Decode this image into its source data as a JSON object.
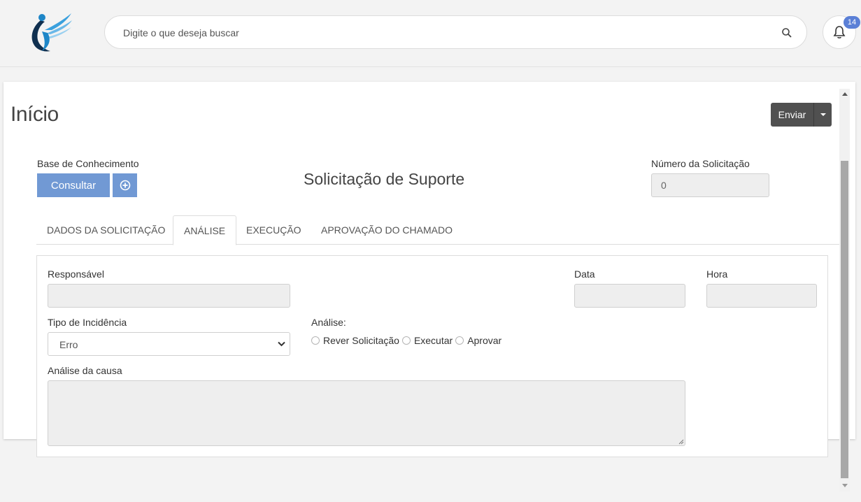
{
  "header": {
    "search_placeholder": "Digite o que deseja buscar",
    "notification_count": "14"
  },
  "page": {
    "title": "Início",
    "send_label": "Enviar"
  },
  "form": {
    "knowledge_base_label": "Base de Conhecimento",
    "consult_label": "Consultar",
    "title": "Solicitação de Suporte",
    "request_number_label": "Número da Solicitação",
    "request_number_value": "0"
  },
  "tabs": [
    {
      "label": "DADOS DA SOLICITAÇÃO"
    },
    {
      "label": "ANÁLISE"
    },
    {
      "label": "EXECUÇÃO"
    },
    {
      "label": "APROVAÇÃO DO CHAMADO"
    }
  ],
  "active_tab": "ANÁLISE",
  "analysis": {
    "responsible_label": "Responsável",
    "date_label": "Data",
    "time_label": "Hora",
    "incidence_type_label": "Tipo de Incidência",
    "incidence_type_value": "Erro",
    "analysis_label": "Análise:",
    "options": [
      "Rever Solicitação",
      "Executar",
      "Aprovar"
    ],
    "cause_label": "Análise da causa"
  },
  "colors": {
    "accent": "#7199d4",
    "badge": "#5a7fd6",
    "send_button": "#505050"
  }
}
